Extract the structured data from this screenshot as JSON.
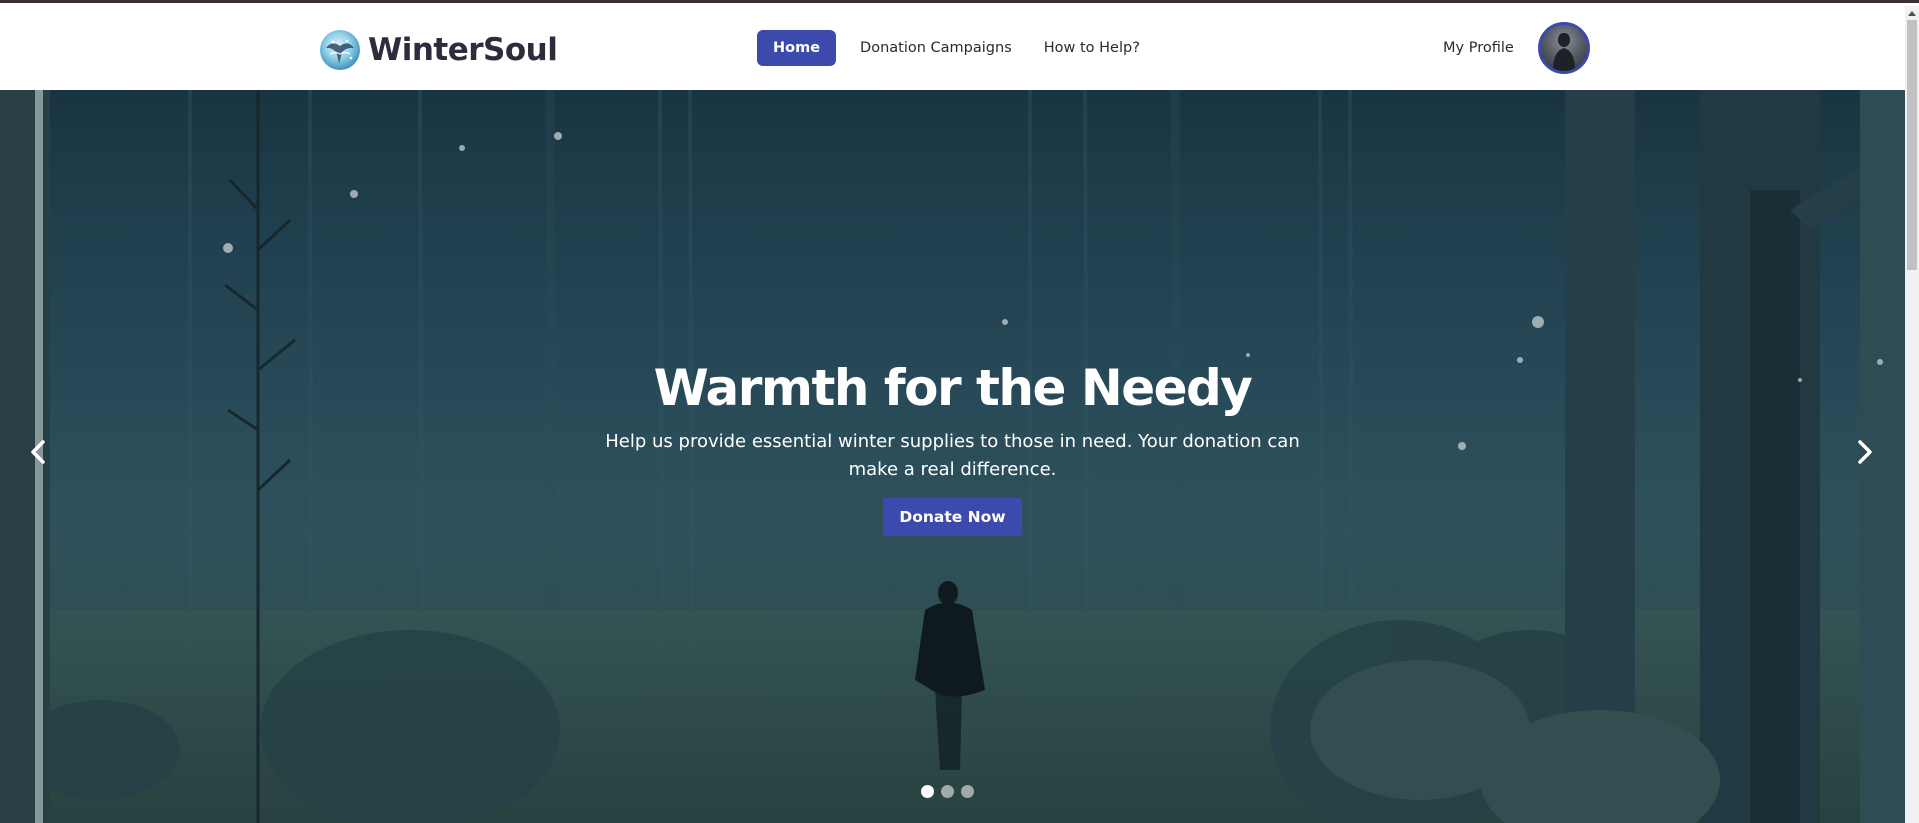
{
  "brand": {
    "name": "WinterSoul"
  },
  "nav": {
    "items": [
      {
        "label": "Home",
        "active": true
      },
      {
        "label": "Donation Campaigns",
        "active": false
      },
      {
        "label": "How to Help?",
        "active": false
      }
    ],
    "profile_label": "My Profile"
  },
  "hero": {
    "title": "Warmth for the Needy",
    "subtitle": "Help us provide essential winter supplies to those in need. Your donation can make a real difference.",
    "cta_label": "Donate Now",
    "slides_count": 3,
    "active_slide": 1
  },
  "colors": {
    "accent": "#3c49ad",
    "text_dark": "#2a2a33",
    "hero_bg": "#24475a"
  },
  "icons": {
    "prev": "chevron-left-icon",
    "next": "chevron-right-icon",
    "scroll_up": "caret-up-icon"
  }
}
